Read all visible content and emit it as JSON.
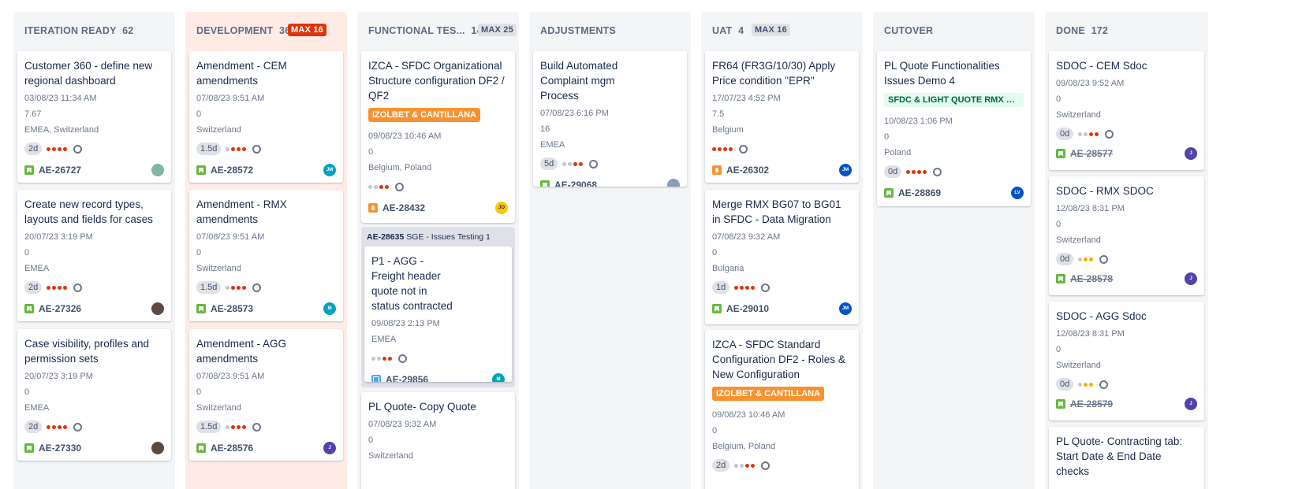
{
  "columns": [
    {
      "name": "ITERATION READY",
      "count": "62",
      "max": "",
      "cards": [
        {
          "title": "Customer 360 - define new regional dashboard",
          "meta": [
            "03/08/23 11:34 AM",
            "7.67",
            "EMEA, Switzerland"
          ],
          "days": "2d",
          "dots": "rrrr",
          "icon": "story",
          "key": "AE-26727",
          "avatar": "photo-avatar-icon",
          "avatar_color": "#7fb7a2",
          "avatar_text": ""
        },
        {
          "title": "Create new record types, layouts and fields for cases",
          "meta": [
            "20/07/23 3:19 PM",
            "0",
            "EMEA"
          ],
          "days": "2d",
          "dots": "rrrr",
          "icon": "story",
          "key": "AE-27326",
          "avatar": "photo-avatar-icon",
          "avatar_color": "#5a4a42",
          "avatar_text": ""
        },
        {
          "title": "Case visibility, profiles and permission sets",
          "meta": [
            "20/07/23 3:19 PM",
            "0",
            "EMEA"
          ],
          "days": "2d",
          "dots": "rrrr",
          "icon": "story",
          "key": "AE-27330",
          "avatar": "photo-avatar-icon",
          "avatar_color": "#5a4a42",
          "avatar_text": ""
        }
      ]
    },
    {
      "name": "DEVELOPMENT",
      "count": "36",
      "max": "MAX 16",
      "cards": [
        {
          "title": "Amendment - CEM amendments",
          "meta": [
            "07/08/23 9:51 AM",
            "0",
            "Switzerland"
          ],
          "days": "1.5d",
          "dots": "grrr",
          "icon": "story",
          "key": "AE-28572",
          "avatar": "user-avatar-icon",
          "avatar_color": "#00a3bf",
          "avatar_text": "JM"
        },
        {
          "title": "Amendment - RMX amendments",
          "meta": [
            "07/08/23 9:51 AM",
            "0",
            "Switzerland"
          ],
          "days": "1.5d",
          "dots": "grrr",
          "icon": "story",
          "key": "AE-28573",
          "avatar": "user-avatar-icon",
          "avatar_color": "#00a3bf",
          "avatar_text": "M"
        },
        {
          "title": "Amendment - AGG amendments",
          "meta": [
            "07/08/23 9:51 AM",
            "0",
            "Switzerland"
          ],
          "days": "1.5d",
          "dots": "grrr",
          "icon": "story",
          "key": "AE-28576",
          "avatar": "user-avatar-icon",
          "avatar_color": "#5243aa",
          "avatar_text": "J"
        }
      ]
    },
    {
      "name": "FUNCTIONAL TES...",
      "count": "14",
      "max": "MAX 25",
      "cards": [
        {
          "title": "IZCA - SFDC Organizational Structure configuration DF2 / QF2",
          "label": "IZOLBET & CANTILLANA",
          "meta": [
            "09/08/23 10:46 AM",
            "0",
            "Belgium, Poland"
          ],
          "days": "",
          "dots": "ggrr",
          "icon": "improve",
          "key": "AE-28432",
          "avatar": "user-avatar-icon",
          "avatar_color": "#ffc400",
          "avatar_text": "JO"
        },
        {
          "parent_key": "AE-28635",
          "parent_title": "SGE - Issues Testing 1",
          "title": "P1 - AGG - Freight header quote not in status contracted",
          "meta": [
            "09/08/23 2:13 PM",
            "EMEA"
          ],
          "days": "",
          "dots": "ggrr",
          "icon": "sub",
          "key": "AE-29856",
          "avatar": "user-avatar-icon",
          "avatar_color": "#00a3bf",
          "avatar_text": "M"
        },
        {
          "title": "PL Quote- Copy Quote",
          "meta": [
            "07/08/23 9:32 AM",
            "0",
            "Switzerland"
          ],
          "days": "",
          "dots": "",
          "icon": "story",
          "key": "",
          "avatar": "",
          "avatar_color": "",
          "avatar_text": ""
        }
      ]
    },
    {
      "name": "ADJUSTMENTS",
      "count": "",
      "max": "",
      "cards": [
        {
          "title": "Build Automated Complaint mgm Process",
          "meta": [
            "07/08/23 6:16 PM",
            "16",
            "EMEA"
          ],
          "days": "5d",
          "dots": "ggrr",
          "icon": "story",
          "key": "AE-29068",
          "avatar": "photo-avatar-icon",
          "avatar_color": "#8a9bb5",
          "avatar_text": ""
        }
      ]
    },
    {
      "name": "UAT",
      "count": "4",
      "max": "MAX 16",
      "cards": [
        {
          "title": "FR64 (FR3G/10/30) Apply Price condition \"EPR\"",
          "meta": [
            "17/07/23 4:52 PM",
            "7.5",
            "Belgium"
          ],
          "days": "",
          "dots": "rrrr",
          "icon": "improve",
          "key": "AE-26302",
          "avatar": "user-avatar-icon",
          "avatar_color": "#0052cc",
          "avatar_text": "JM"
        },
        {
          "title": "Merge RMX BG07 to BG01 in SFDC - Data Migration",
          "meta": [
            "07/08/23 9:32 AM",
            "0",
            "Bulgaria"
          ],
          "days": "1d",
          "dots": "rrrr",
          "icon": "story",
          "key": "AE-29010",
          "avatar": "user-avatar-icon",
          "avatar_color": "#0052cc",
          "avatar_text": "JM"
        },
        {
          "title": "IZCA - SFDC Standard Configuration DF2 - Roles & New Configuration",
          "label": "IZOLBET & CANTILLANA",
          "meta": [
            "09/08/23 10:46 AM",
            "0",
            "Belgium, Poland"
          ],
          "days": "2d",
          "dots": "ggrr",
          "icon": "story",
          "key": "",
          "avatar": "",
          "avatar_color": "",
          "avatar_text": ""
        }
      ]
    },
    {
      "name": "CUTOVER",
      "count": "",
      "max": "",
      "cards": [
        {
          "title": "PL Quote Functionalities Issues Demo 4",
          "label": "SFDC & LIGHT QUOTE RMX POL...",
          "label_style": "green",
          "meta": [
            "10/08/23 1:06 PM",
            "0",
            "Poland"
          ],
          "days": "0d",
          "dots": "rrrr",
          "icon": "story",
          "key": "AE-28869",
          "avatar": "user-avatar-icon",
          "avatar_color": "#0052cc",
          "avatar_text": "LV"
        }
      ]
    },
    {
      "name": "DONE",
      "count": "172",
      "max": "",
      "cards": [
        {
          "title": "SDOC - CEM Sdoc",
          "meta": [
            "09/08/23 9:52 AM",
            "0",
            "Switzerland"
          ],
          "days": "0d",
          "dots": "ggrr",
          "icon": "story",
          "key": "AE-28577",
          "done": true,
          "avatar": "user-avatar-icon",
          "avatar_color": "#5243aa",
          "avatar_text": "J"
        },
        {
          "title": "SDOC - RMX SDOC",
          "meta": [
            "12/08/23 8:31 PM",
            "0",
            "Switzerland"
          ],
          "days": "0d",
          "dots": "gyy",
          "icon": "story",
          "key": "AE-28578",
          "done": true,
          "avatar": "user-avatar-icon",
          "avatar_color": "#5243aa",
          "avatar_text": "J"
        },
        {
          "title": "SDOC - AGG Sdoc",
          "meta": [
            "12/08/23 8:31 PM",
            "0",
            "Switzerland"
          ],
          "days": "0d",
          "dots": "gyy",
          "icon": "story",
          "key": "AE-28579",
          "done": true,
          "avatar": "user-avatar-icon",
          "avatar_color": "#5243aa",
          "avatar_text": "J"
        },
        {
          "title": "PL Quote- Contracting tab: Start Date & End Date checks",
          "meta": [],
          "days": "",
          "dots": "",
          "icon": "story",
          "key": "",
          "avatar": "",
          "avatar_color": "",
          "avatar_text": ""
        }
      ]
    }
  ]
}
